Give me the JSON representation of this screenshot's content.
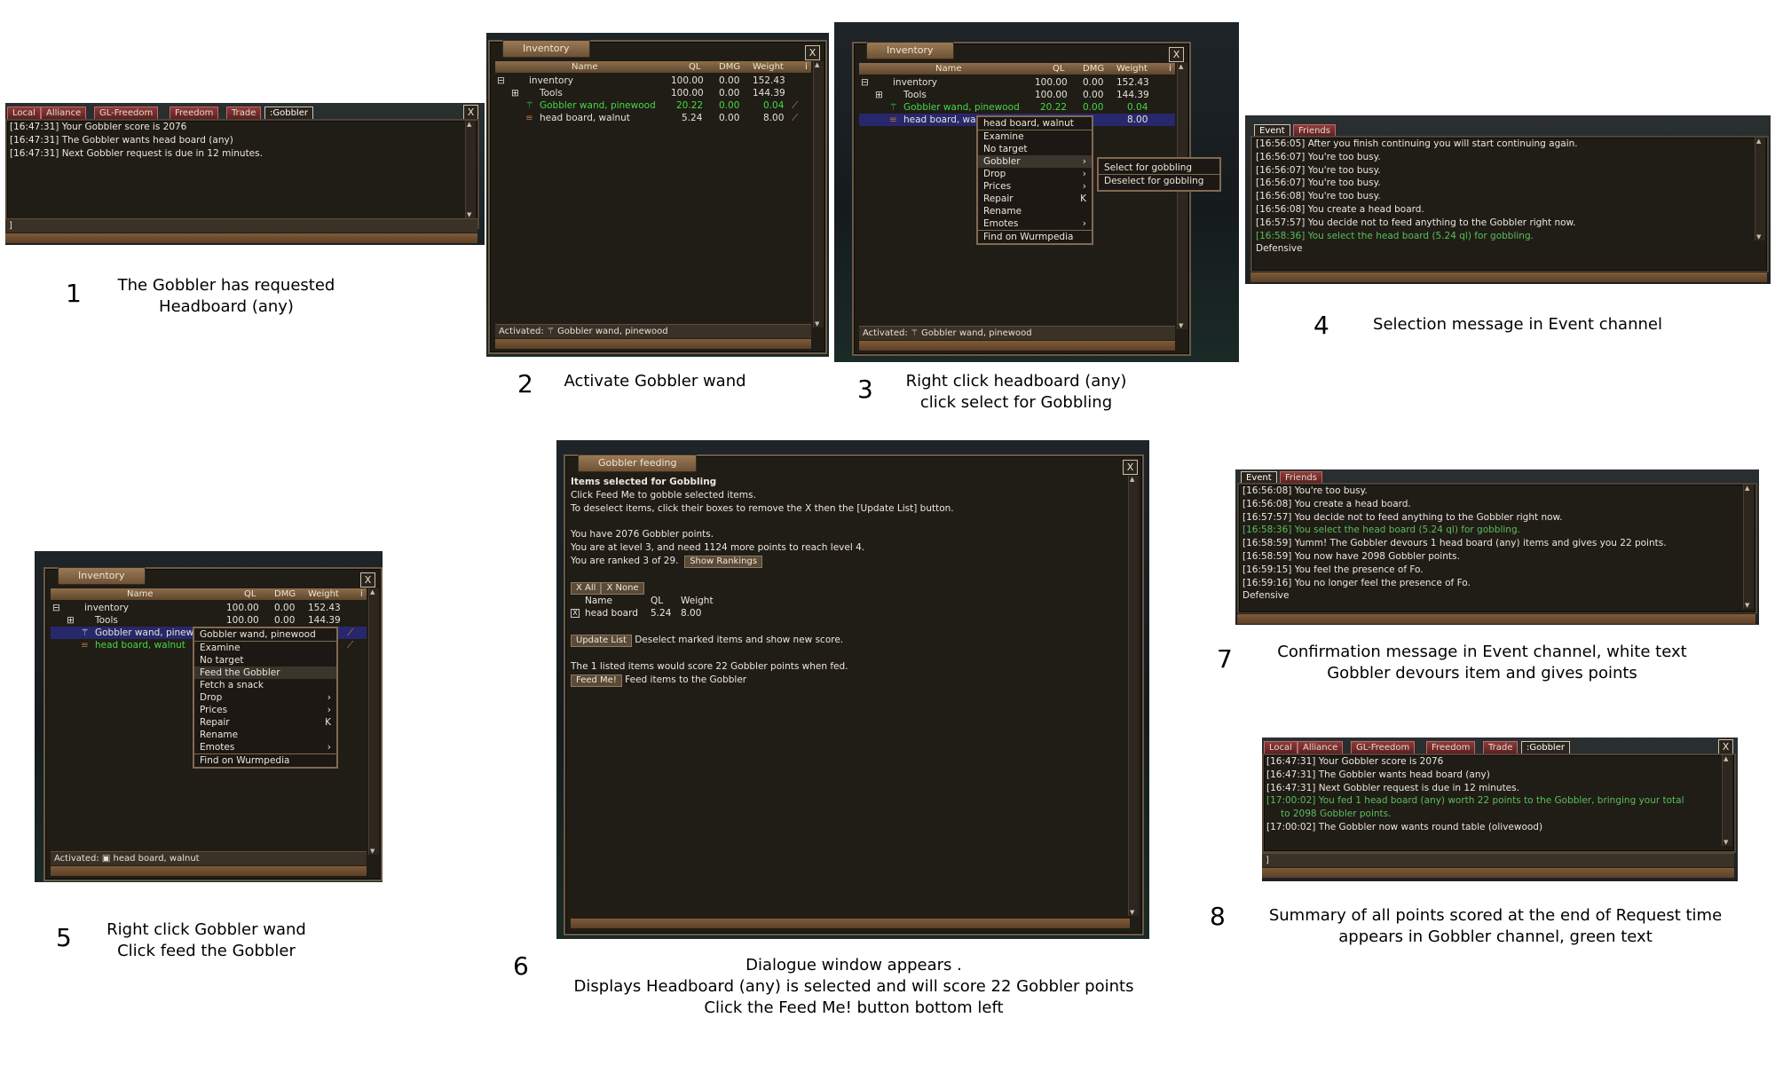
{
  "steps": [
    {
      "number": "1",
      "caption": [
        "The Gobbler has requested",
        "Headboard (any)"
      ]
    },
    {
      "number": "2",
      "caption": [
        "Activate Gobbler wand"
      ]
    },
    {
      "number": "3",
      "caption": [
        "Right click headboard (any)",
        "click select for Gobbling"
      ]
    },
    {
      "number": "4",
      "caption": [
        "Selection message in Event channel"
      ]
    },
    {
      "number": "5",
      "caption": [
        "Right click Gobbler wand",
        "Click feed the Gobbler"
      ]
    },
    {
      "number": "6",
      "caption": [
        "Dialogue window appears .",
        "Displays Headboard (any) is selected and will score 22 Gobbler points",
        "Click the Feed Me! button bottom left"
      ]
    },
    {
      "number": "7",
      "caption": [
        "Confirmation message in Event channel, white text",
        "Gobbler devours item and gives points"
      ]
    },
    {
      "number": "8",
      "caption": [
        "Summary of all points scored at the end of Request time",
        "appears in Gobbler channel, green text"
      ]
    }
  ],
  "chat_tabs": [
    "Local",
    "Alliance",
    "GL-Freedom",
    "Freedom",
    "Trade",
    ":Gobbler"
  ],
  "event_tabs": [
    "Event",
    "Friends"
  ],
  "close_glyph": "X",
  "chat_prompt": "]",
  "shot1_lines": [
    "[16:47:31] Your Gobbler score is 2076",
    "[16:47:31] The Gobbler wants head board (any)",
    "[16:47:31] Next Gobbler request is due in 12 minutes."
  ],
  "inventory": {
    "title": "Inventory",
    "columns": {
      "name": "Name",
      "ql": "QL",
      "dmg": "DMG",
      "weight": "Weight",
      "more": "i"
    },
    "rows": [
      {
        "tree": "⊟",
        "name": "inventory",
        "ql": "100.00",
        "dmg": "0.00",
        "weight": "152.43"
      },
      {
        "tree": "⊞",
        "name": "Tools",
        "ql": "100.00",
        "dmg": "0.00",
        "weight": "144.39"
      },
      {
        "tree": "",
        "name": "Gobbler wand, pinewood",
        "ql": "20.22",
        "dmg": "0.00",
        "weight": "0.04"
      },
      {
        "tree": "",
        "name": "head board, walnut",
        "ql": "5.24",
        "dmg": "0.00",
        "weight": "8.00"
      }
    ],
    "activated_label": "Activated:",
    "activated_item": "Gobbler wand, pinewood",
    "activated_item5": "head board, walnut"
  },
  "shot3_menu": {
    "items": [
      "head board, walnut",
      "Examine",
      "No target",
      "Gobbler",
      "Drop",
      "Prices",
      "Repair",
      "Rename",
      "Emotes",
      "Find on Wurmpedia"
    ],
    "repair_key": "K",
    "submenu": [
      "Select for gobbling",
      "Deselect for gobbling"
    ]
  },
  "shot4_lines": [
    "[16:56:05] After you finish continuing you will start continuing again.",
    "[16:56:07] You're too busy.",
    "[16:56:07] You're too busy.",
    "[16:56:07] You're too busy.",
    "[16:56:08] You're too busy.",
    "[16:56:08] You create a head board.",
    "[16:57:57] You decide not to feed anything to the Gobbler right now.",
    "[16:58:36] You select the head board (5.24 ql) for gobbling.",
    "Defensive"
  ],
  "shot5_menu": {
    "items": [
      "Gobbler wand, pinewood",
      "Examine",
      "No target",
      "Feed the Gobbler",
      "Fetch a snack",
      "Drop",
      "Prices",
      "Repair",
      "Rename",
      "Emotes",
      "Find on Wurmpedia"
    ],
    "repair_key": "K"
  },
  "shot6": {
    "title": "Gobbler feeding",
    "heading": "Items selected for Gobbling",
    "line1": "Click Feed Me to gobble selected items.",
    "line2": "To deselect items, click their boxes to remove the X then the [Update List] button.",
    "points": "You have 2076 Gobbler points.",
    "level": "You are at level 3, and need 1124 more points to reach level 4.",
    "rank": "You are ranked 3 of 29.",
    "show_rankings": "Show Rankings",
    "x_all": "X All",
    "x_none": "X None",
    "col_name": "Name",
    "col_ql": "QL",
    "col_weight": "Weight",
    "check_mark": "X",
    "item_name": "head board",
    "item_ql": "5.24",
    "item_weight": "8.00",
    "update_list": "Update List",
    "update_desc": "Deselect marked items and show new score.",
    "score_line": "The 1 listed items would score 22 Gobbler points when fed.",
    "feed_me": "Feed Me!",
    "feed_desc": "Feed items to the Gobbler"
  },
  "shot7_lines": [
    "[16:56:08] You're too busy.",
    "[16:56:08] You create a head board.",
    "[16:57:57] You decide not to feed anything to the Gobbler right now.",
    "[16:58:36] You select the head board (5.24 ql) for gobbling.",
    "[16:58:59] Yumm! The Gobbler devours 1 head board (any) items and gives you 22 points.",
    "[16:58:59] You now have 2098 Gobbler points.",
    "[16:59:15] You feel the presence of Fo.",
    "[16:59:16] You no longer feel the presence of Fo.",
    "Defensive"
  ],
  "shot8_lines": [
    "[16:47:31] Your Gobbler score is 2076",
    "[16:47:31] The Gobbler wants head board (any)",
    "[16:47:31] Next Gobbler request is due in 12 minutes.",
    "[17:00:02] You fed 1 head board (any) worth 22 points to the Gobbler, bringing your total",
    "to 2098 Gobbler points.",
    "[17:00:02] The Gobbler now wants round table (olivewood)"
  ],
  "colors": {
    "green_text": "#59bf59",
    "item_green": "#43d943",
    "selected_row": "#27286c",
    "tab_red": "#8f3a3a"
  }
}
